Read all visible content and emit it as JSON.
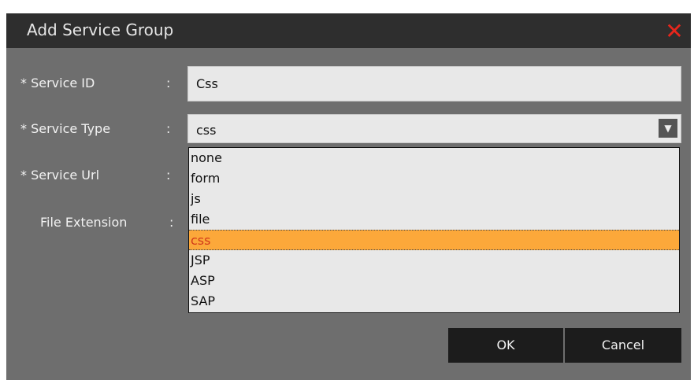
{
  "dialog": {
    "title": "Add Service Group",
    "close_icon": "close-icon"
  },
  "fields": {
    "service_id": {
      "label": "* Service ID",
      "colon": ":",
      "value": "Css"
    },
    "service_type": {
      "label": "* Service Type",
      "colon": ":",
      "value": "css"
    },
    "service_url": {
      "label": "* Service Url",
      "colon": ":"
    },
    "file_extension": {
      "label": "File Extension",
      "colon": ":"
    }
  },
  "dropdown": {
    "options": [
      "none",
      "form",
      "js",
      "file",
      "css",
      "JSP",
      "ASP",
      "SAP"
    ],
    "selected": "css"
  },
  "buttons": {
    "ok": "OK",
    "cancel": "Cancel"
  },
  "colors": {
    "accent": "#fca83a",
    "close": "#e8261c"
  }
}
